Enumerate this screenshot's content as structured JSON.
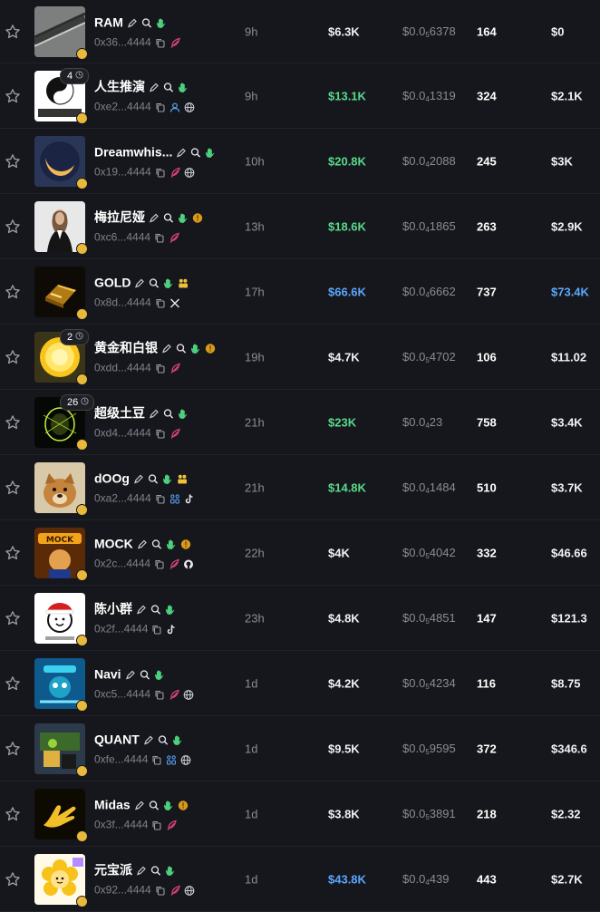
{
  "colors": {
    "green": "#58d98b",
    "blue": "#5aa7ff",
    "white": "#f2f2f5",
    "muted": "#8a8c96",
    "bg": "#16171c"
  },
  "rows": [
    {
      "name": "RAM",
      "addr": "0x36...4444",
      "age": "9h",
      "mcap": "$6.3K",
      "mcap_color": "white",
      "price_prefix": "$0.0",
      "price_zeros": "5",
      "price_digits": "6378",
      "holders": "164",
      "volume": "$0",
      "volume_color": "white",
      "badge_count": "",
      "socials": [
        "copy-icon",
        "feather-icon"
      ],
      "extra_tags": [],
      "avatar": "metal-rail"
    },
    {
      "name": "人生推演",
      "addr": "0xe2...4444",
      "age": "9h",
      "mcap": "$13.1K",
      "mcap_color": "green",
      "price_prefix": "$0.0",
      "price_zeros": "4",
      "price_digits": "1319",
      "holders": "324",
      "volume": "$2.1K",
      "volume_color": "white",
      "badge_count": "4",
      "socials": [
        "copy-icon",
        "user-icon",
        "globe-icon"
      ],
      "extra_tags": [],
      "avatar": "yinyang"
    },
    {
      "name": "Dreamwhis...",
      "addr": "0x19...4444",
      "age": "10h",
      "mcap": "$20.8K",
      "mcap_color": "green",
      "price_prefix": "$0.0",
      "price_zeros": "4",
      "price_digits": "2088",
      "holders": "245",
      "volume": "$3K",
      "volume_color": "white",
      "badge_count": "",
      "socials": [
        "copy-icon",
        "feather-icon",
        "globe-icon"
      ],
      "extra_tags": [],
      "avatar": "moon"
    },
    {
      "name": "梅拉尼娅",
      "addr": "0xc6...4444",
      "age": "13h",
      "mcap": "$18.6K",
      "mcap_color": "green",
      "price_prefix": "$0.0",
      "price_zeros": "4",
      "price_digits": "1865",
      "holders": "263",
      "volume": "$2.9K",
      "volume_color": "white",
      "badge_count": "",
      "socials": [
        "copy-icon",
        "feather-icon"
      ],
      "extra_tags": [
        "coin-tag"
      ],
      "avatar": "woman"
    },
    {
      "name": "GOLD",
      "addr": "0x8d...4444",
      "age": "17h",
      "mcap": "$66.6K",
      "mcap_color": "blue",
      "price_prefix": "$0.0",
      "price_zeros": "4",
      "price_digits": "6662",
      "holders": "737",
      "volume": "$73.4K",
      "volume_color": "blue",
      "badge_count": "",
      "socials": [
        "copy-icon",
        "x-icon"
      ],
      "extra_tags": [
        "users-tag"
      ],
      "avatar": "gold"
    },
    {
      "name": "黄金和白银",
      "addr": "0xdd...4444",
      "age": "19h",
      "mcap": "$4.7K",
      "mcap_color": "white",
      "price_prefix": "$0.0",
      "price_zeros": "5",
      "price_digits": "4702",
      "holders": "106",
      "volume": "$11.02",
      "volume_color": "white",
      "badge_count": "2",
      "socials": [
        "copy-icon",
        "feather-icon"
      ],
      "extra_tags": [
        "coin-tag"
      ],
      "avatar": "coin"
    },
    {
      "name": "超级土豆",
      "addr": "0xd4...4444",
      "age": "21h",
      "mcap": "$23K",
      "mcap_color": "green",
      "price_prefix": "$0.0",
      "price_zeros": "4",
      "price_digits": "23",
      "holders": "758",
      "volume": "$3.4K",
      "volume_color": "white",
      "badge_count": "26",
      "socials": [
        "copy-icon",
        "feather-icon"
      ],
      "extra_tags": [],
      "avatar": "potato"
    },
    {
      "name": "dOOg",
      "addr": "0xa2...4444",
      "age": "21h",
      "mcap": "$14.8K",
      "mcap_color": "green",
      "price_prefix": "$0.0",
      "price_zeros": "4",
      "price_digits": "1484",
      "holders": "510",
      "volume": "$3.7K",
      "volume_color": "white",
      "badge_count": "",
      "socials": [
        "copy-icon",
        "people-icon",
        "tiktok-icon"
      ],
      "extra_tags": [
        "users-tag"
      ],
      "avatar": "dog"
    },
    {
      "name": "MOCK",
      "addr": "0x2c...4444",
      "age": "22h",
      "mcap": "$4K",
      "mcap_color": "white",
      "price_prefix": "$0.0",
      "price_zeros": "5",
      "price_digits": "4042",
      "holders": "332",
      "volume": "$46.66",
      "volume_color": "white",
      "badge_count": "",
      "socials": [
        "copy-icon",
        "feather-icon",
        "github-icon"
      ],
      "extra_tags": [
        "coin-tag"
      ],
      "avatar": "mock"
    },
    {
      "name": "陈小群",
      "addr": "0x2f...4444",
      "age": "23h",
      "mcap": "$4.8K",
      "mcap_color": "white",
      "price_prefix": "$0.0",
      "price_zeros": "5",
      "price_digits": "4851",
      "holders": "147",
      "volume": "$121.3",
      "volume_color": "white",
      "badge_count": "",
      "socials": [
        "copy-icon",
        "tiktok-icon"
      ],
      "extra_tags": [],
      "avatar": "santa"
    },
    {
      "name": "Navi",
      "addr": "0xc5...4444",
      "age": "1d",
      "mcap": "$4.2K",
      "mcap_color": "white",
      "price_prefix": "$0.0",
      "price_zeros": "5",
      "price_digits": "4234",
      "holders": "116",
      "volume": "$8.75",
      "volume_color": "white",
      "badge_count": "",
      "socials": [
        "copy-icon",
        "feather-icon",
        "globe-icon"
      ],
      "extra_tags": [],
      "avatar": "navi"
    },
    {
      "name": "QUANT",
      "addr": "0xfe...4444",
      "age": "1d",
      "mcap": "$9.5K",
      "mcap_color": "white",
      "price_prefix": "$0.0",
      "price_zeros": "5",
      "price_digits": "9595",
      "holders": "372",
      "volume": "$346.6",
      "volume_color": "white",
      "badge_count": "",
      "socials": [
        "copy-icon",
        "people-icon",
        "globe-icon"
      ],
      "extra_tags": [],
      "avatar": "quant"
    },
    {
      "name": "Midas",
      "addr": "0x3f...4444",
      "age": "1d",
      "mcap": "$3.8K",
      "mcap_color": "white",
      "price_prefix": "$0.0",
      "price_zeros": "5",
      "price_digits": "3891",
      "holders": "218",
      "volume": "$2.32",
      "volume_color": "white",
      "badge_count": "",
      "socials": [
        "copy-icon",
        "feather-icon"
      ],
      "extra_tags": [
        "coin-tag"
      ],
      "avatar": "hand"
    },
    {
      "name": "元宝派",
      "addr": "0x92...4444",
      "age": "1d",
      "mcap": "$43.8K",
      "mcap_color": "blue",
      "price_prefix": "$0.0",
      "price_zeros": "4",
      "price_digits": "439",
      "holders": "443",
      "volume": "$2.7K",
      "volume_color": "white",
      "badge_count": "",
      "socials": [
        "copy-icon",
        "feather-icon",
        "globe-icon"
      ],
      "extra_tags": [],
      "avatar": "flower"
    }
  ]
}
